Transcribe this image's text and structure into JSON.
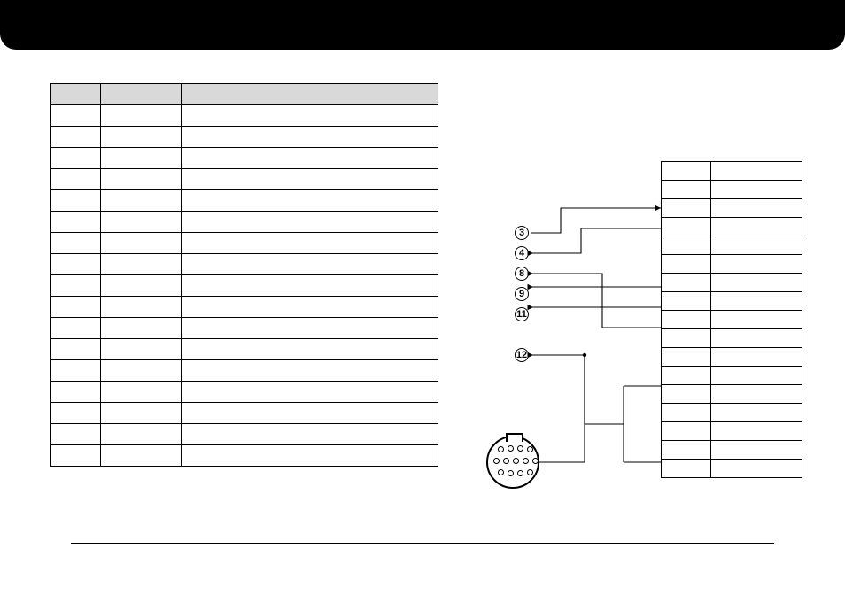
{
  "leftTable": {
    "headers": [
      "",
      "",
      ""
    ],
    "rows": [
      [
        "",
        "",
        ""
      ],
      [
        "",
        "",
        ""
      ],
      [
        "",
        "",
        ""
      ],
      [
        "",
        "",
        ""
      ],
      [
        "",
        "",
        ""
      ],
      [
        "",
        "",
        ""
      ],
      [
        "",
        "",
        ""
      ],
      [
        "",
        "",
        ""
      ],
      [
        "",
        "",
        ""
      ],
      [
        "",
        "",
        ""
      ],
      [
        "",
        "",
        ""
      ],
      [
        "",
        "",
        ""
      ],
      [
        "",
        "",
        ""
      ],
      [
        "",
        "",
        ""
      ],
      [
        "",
        "",
        ""
      ],
      [
        "",
        "",
        ""
      ],
      [
        "",
        "",
        ""
      ]
    ]
  },
  "rightTable": {
    "rows": [
      [
        "",
        ""
      ],
      [
        "",
        ""
      ],
      [
        "",
        ""
      ],
      [
        "",
        ""
      ],
      [
        "",
        ""
      ],
      [
        "",
        ""
      ],
      [
        "",
        ""
      ],
      [
        "",
        ""
      ],
      [
        "",
        ""
      ],
      [
        "",
        ""
      ],
      [
        "",
        ""
      ],
      [
        "",
        ""
      ],
      [
        "",
        ""
      ],
      [
        "",
        ""
      ],
      [
        "",
        ""
      ],
      [
        "",
        ""
      ],
      [
        "",
        ""
      ]
    ]
  },
  "diagramLabels": {
    "l3": "3",
    "l4": "4",
    "l8": "8",
    "l9": "9",
    "l11": "11",
    "l12": "12"
  }
}
